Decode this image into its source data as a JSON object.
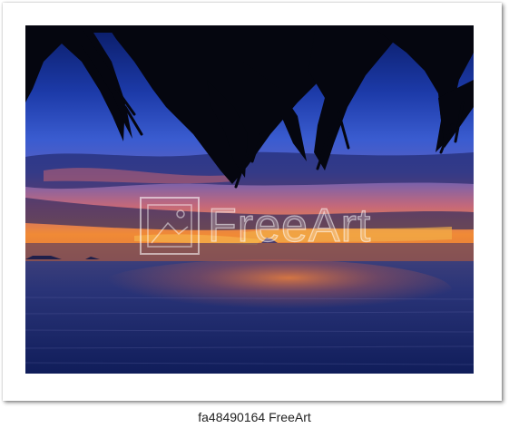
{
  "caption": "fa48490164 FreeArt",
  "watermark": {
    "text": "FreeArt"
  },
  "colors": {
    "sky_top": "#0c2378",
    "sky_mid": "#3a55c8",
    "horizon_orange": "#f08a2a",
    "sea": "#1b2a63",
    "frame": "#ffffff"
  }
}
